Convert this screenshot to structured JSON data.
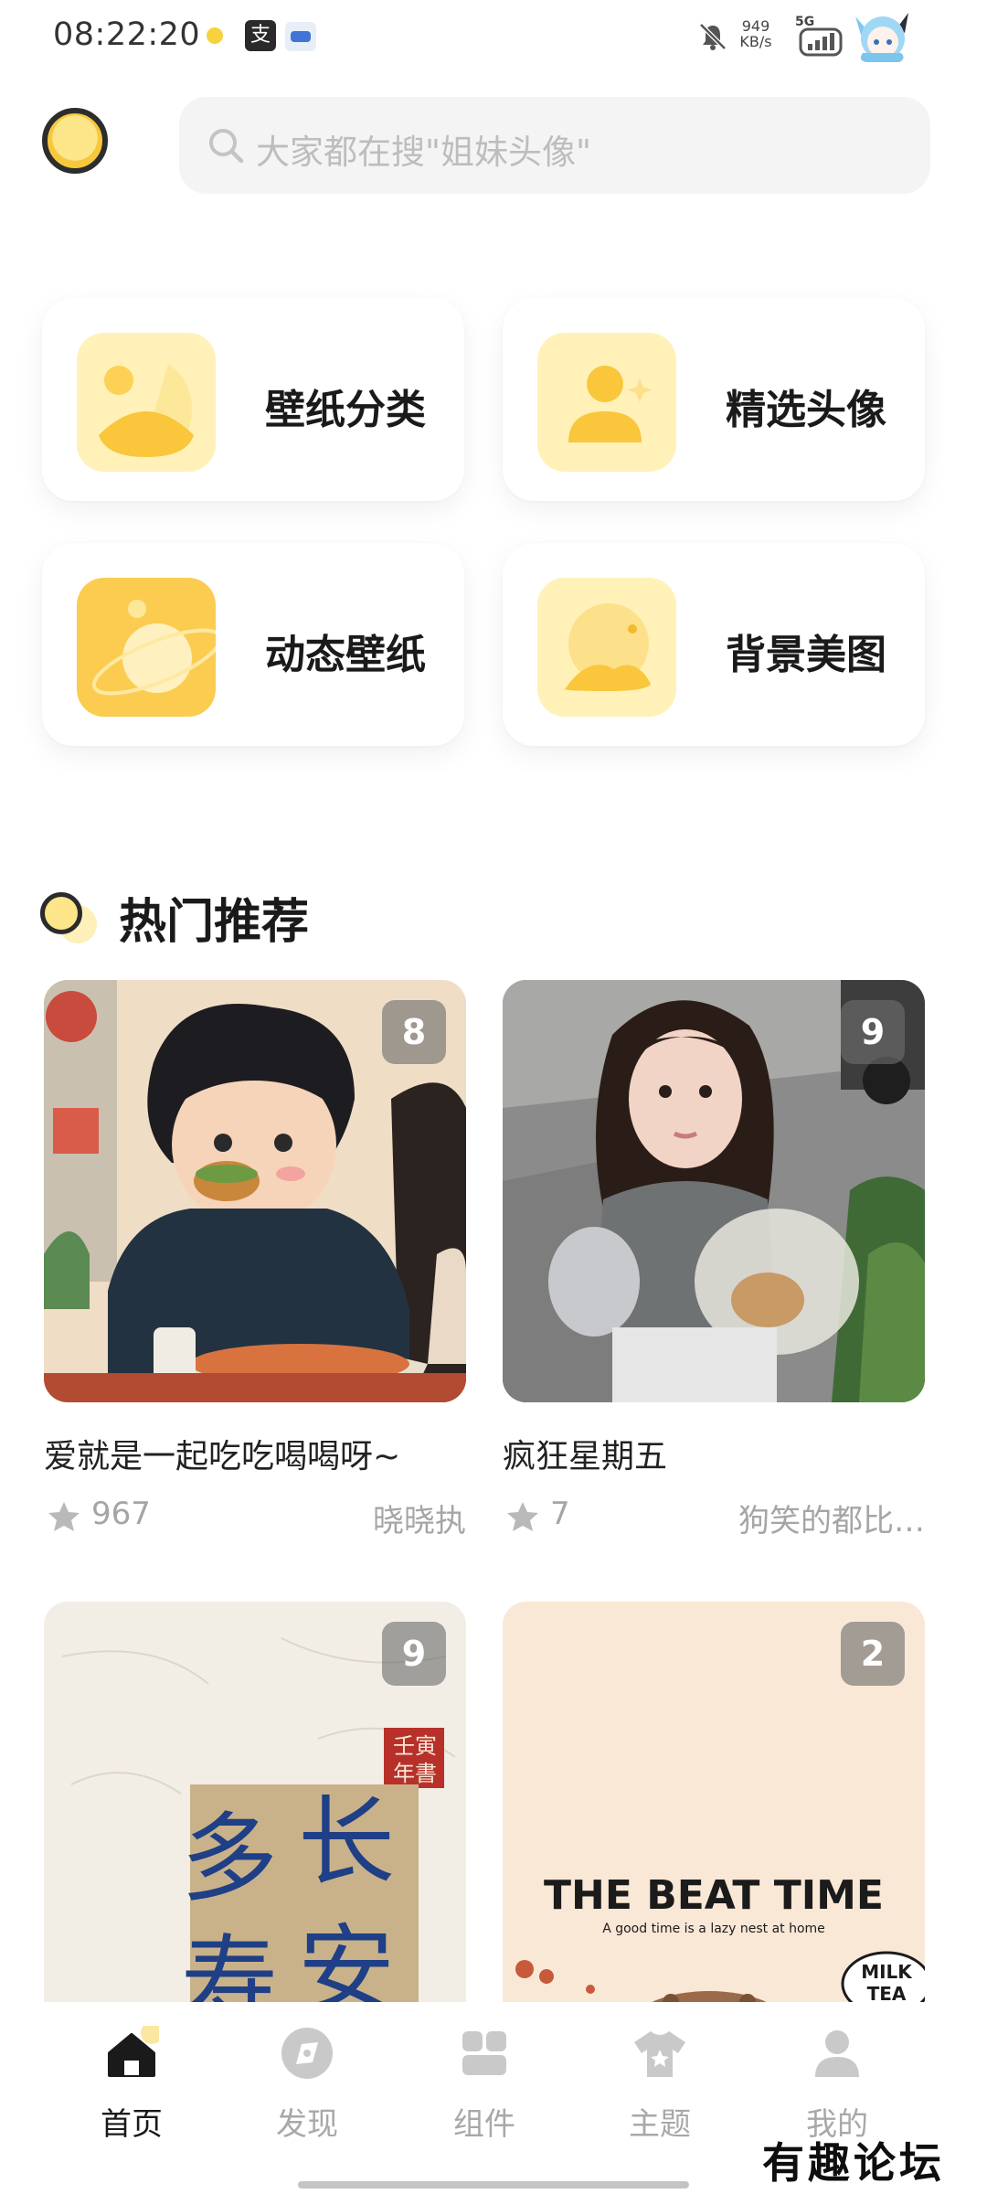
{
  "status_bar": {
    "time": "08:22:20",
    "network_speed_value": "949",
    "network_speed_unit": "KB/s",
    "network_type": "5G",
    "icons": [
      "moon-icon",
      "alipay-icon",
      "app-icon",
      "mute-icon",
      "signal-icon",
      "avatar-icon"
    ]
  },
  "header": {
    "search_placeholder": "大家都在搜\"姐妹头像\""
  },
  "categories": [
    {
      "label": "壁纸分类",
      "icon": "wallpaper-category-icon"
    },
    {
      "label": "精选头像",
      "icon": "featured-avatar-icon"
    },
    {
      "label": "动态壁纸",
      "icon": "live-wallpaper-icon"
    },
    {
      "label": "背景美图",
      "icon": "background-image-icon"
    }
  ],
  "section": {
    "title": "热门推荐"
  },
  "recommendations": [
    {
      "title": "爱就是一起吃吃喝喝呀~",
      "likes": "967",
      "author": "晓晓执",
      "count": "8"
    },
    {
      "title": "疯狂星期五",
      "likes": "7",
      "author": "狗笑的都比…",
      "count": "9"
    },
    {
      "title": "",
      "likes": "",
      "author": "",
      "count": "9",
      "image_text": [
        "壬寅",
        "年書",
        "多",
        "长",
        "寿",
        "安"
      ]
    },
    {
      "title": "",
      "likes": "",
      "author": "",
      "count": "2",
      "image_text": [
        "THE BEAT TIME",
        "A good time is a lazy nest at home",
        "MILK",
        "TEA"
      ]
    }
  ],
  "bottom_nav": [
    {
      "label": "首页",
      "icon": "home-icon",
      "active": true
    },
    {
      "label": "发现",
      "icon": "discover-icon",
      "active": false
    },
    {
      "label": "组件",
      "icon": "widget-icon",
      "active": false
    },
    {
      "label": "主题",
      "icon": "theme-icon",
      "active": false
    },
    {
      "label": "我的",
      "icon": "profile-icon",
      "active": false
    }
  ],
  "watermark": "有趣论坛",
  "colors": {
    "accent_yellow": "#f7c83c",
    "light_yellow": "#fdefb2",
    "text_primary": "#1a1a1a",
    "text_secondary": "#a5a5a5"
  }
}
